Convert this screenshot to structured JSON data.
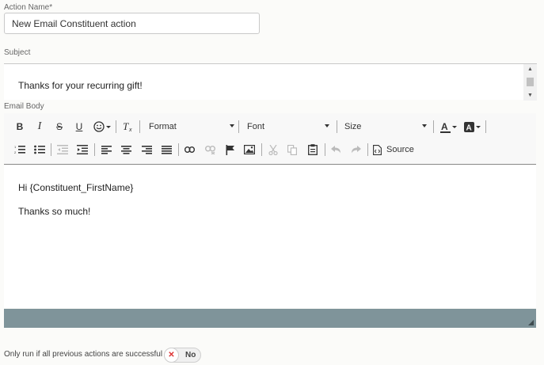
{
  "action_name": {
    "label": "Action Name*",
    "value": "New Email Constituent action"
  },
  "subject": {
    "label": "Subject",
    "value": "Thanks for your recurring gift!"
  },
  "email_body": {
    "label": "Email Body",
    "toolbar": {
      "format_label": "Format",
      "font_label": "Font",
      "size_label": "Size",
      "source_label": "Source"
    },
    "lines": [
      "Hi {Constituent_FirstName}",
      "Thanks so much!"
    ]
  },
  "only_run": {
    "label": "Only run if all previous actions are successful",
    "toggle_value": "No"
  }
}
